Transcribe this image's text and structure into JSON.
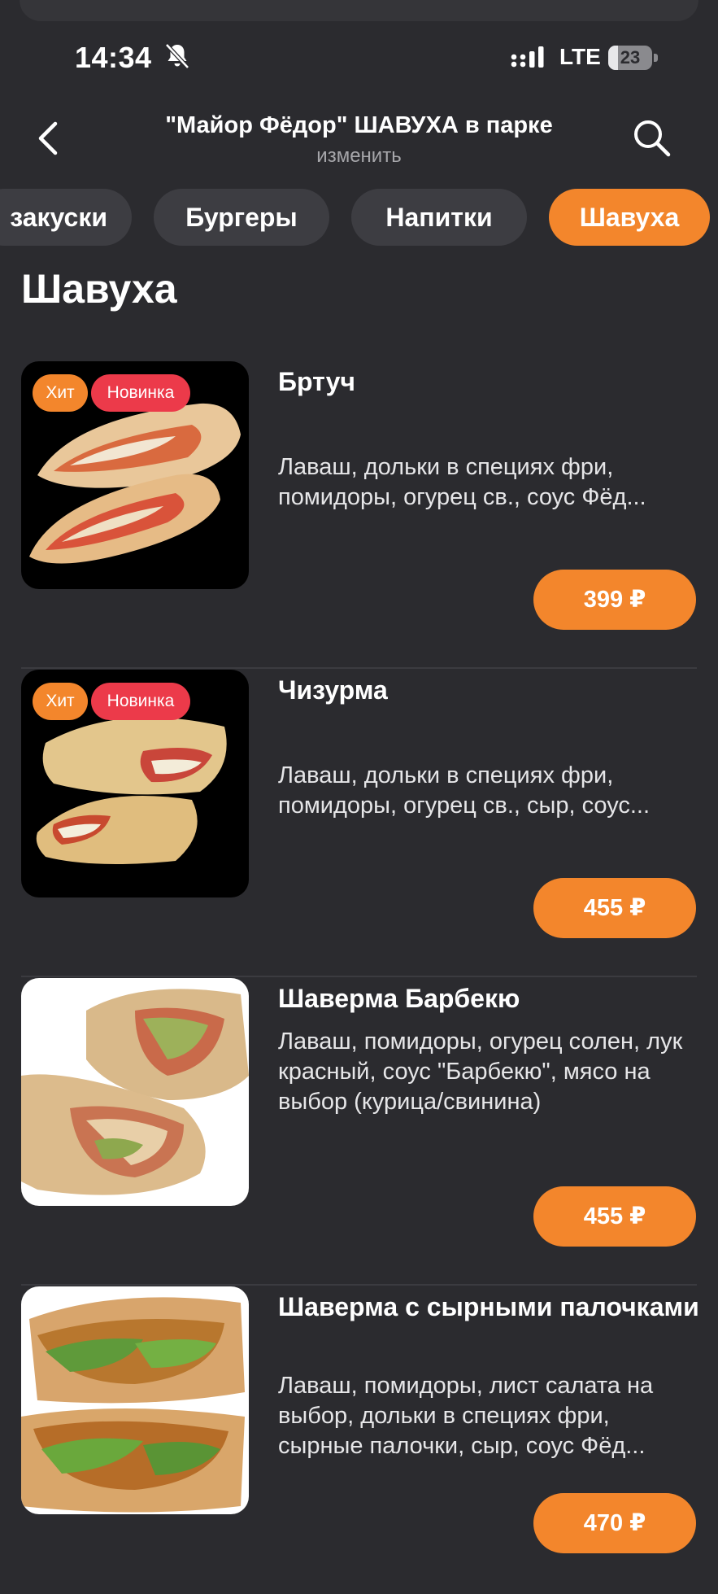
{
  "status_bar": {
    "time": "14:34",
    "network": "LTE",
    "battery_level": "23"
  },
  "header": {
    "title": "\"Майор Фёдор\" ШАВУХА в парке",
    "subtitle": "изменить"
  },
  "tabs": [
    {
      "label": "закуски",
      "active": false
    },
    {
      "label": "Бургеры",
      "active": false
    },
    {
      "label": "Напитки",
      "active": false
    },
    {
      "label": "Шавуха",
      "active": true
    }
  ],
  "section": {
    "title": "Шавуха"
  },
  "items": [
    {
      "name": "Бртуч",
      "description": "Лаваш, дольки в специях фри, помидоры, огурец св., соус Фёд...",
      "price": "399 ₽",
      "badges": [
        "Хит",
        "Новинка"
      ]
    },
    {
      "name": "Чизурма",
      "description": "Лаваш, дольки в специях фри, помидоры, огурец св., сыр, соус...",
      "price": "455 ₽",
      "badges": [
        "Хит",
        "Новинка"
      ]
    },
    {
      "name": "Шаверма Барбекю",
      "description": "Лаваш, помидоры, огурец солен, лук красный, соус \"Барбекю\", мясо на выбор (курица/свинина)",
      "price": "455 ₽",
      "badges": []
    },
    {
      "name": "Шаверма  с сырными палочками",
      "description": "Лаваш, помидоры, лист салата на выбор, дольки в специях фри, сырные палочки, сыр, соус Фёд...",
      "price": "470 ₽",
      "badges": []
    }
  ],
  "colors": {
    "accent": "#f3862c",
    "badge_new": "#ec3a4a",
    "background": "#2b2b2f",
    "tab": "#3d3d42"
  },
  "icons": {
    "back": "chevron-left-icon",
    "search": "search-icon",
    "mute": "bell-slash-icon"
  }
}
